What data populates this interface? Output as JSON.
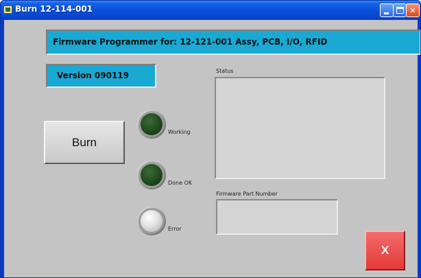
{
  "window": {
    "title": "Burn 12-114-001",
    "icon": "app-icon"
  },
  "header": {
    "text": "Firmware Programmer for:  12-121-001 Assy, PCB, I/O, RFID"
  },
  "version": {
    "text": "Version 090119"
  },
  "status": {
    "label": "Status",
    "value": ""
  },
  "firmware": {
    "label": "Firmware Part Number",
    "value": ""
  },
  "burn_button": {
    "label": "Burn"
  },
  "leds": {
    "working": {
      "label": "Working",
      "state": "off",
      "color": "#1f4a1b"
    },
    "done": {
      "label": "Done OK",
      "state": "off",
      "color": "#1f4a1b"
    },
    "error": {
      "label": "Error",
      "state": "off",
      "color": "#e2e2e2"
    }
  },
  "exit_button": {
    "label": "X",
    "color": "#e43a3a"
  },
  "colors": {
    "accent_bar": "#19a9d2",
    "panel_bg": "#c4c4c4",
    "title_bar": "#0a4fd8"
  }
}
